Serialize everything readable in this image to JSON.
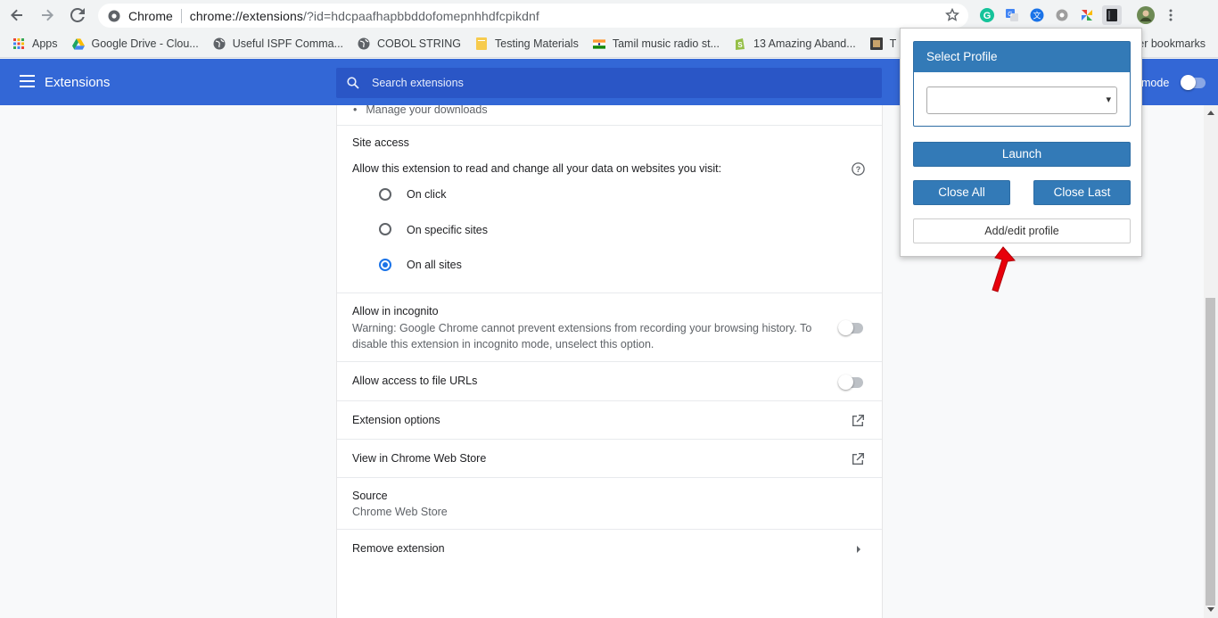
{
  "browser": {
    "omnibox": {
      "site_label": "Chrome",
      "url_scheme_host": "chrome://extensions",
      "url_rest": "/?id=hdcpaafhapbbddofomepnhhdfcpikdnf"
    },
    "bookmarks": [
      {
        "label": "Apps",
        "icon": "apps-grid-icon"
      },
      {
        "label": "Google Drive - Clou...",
        "icon": "google-drive-icon"
      },
      {
        "label": "Useful ISPF Comma...",
        "icon": "globe-icon"
      },
      {
        "label": "COBOL STRING",
        "icon": "globe-icon"
      },
      {
        "label": "Testing Materials",
        "icon": "note-icon"
      },
      {
        "label": "Tamil music radio st...",
        "icon": "india-flag-icon"
      },
      {
        "label": "13 Amazing Aband...",
        "icon": "shopify-icon"
      },
      {
        "label": "T",
        "icon": "bookmark-site-icon"
      }
    ],
    "other_bookmarks": "er bookmarks"
  },
  "header": {
    "title": "Extensions",
    "search_placeholder": "Search extensions",
    "dev_mode_label": "mode"
  },
  "details": {
    "permission_tail": "Manage your downloads",
    "site_access": {
      "label": "Site access",
      "description": "Allow this extension to read and change all your data on websites you visit:",
      "options": [
        {
          "label": "On click",
          "checked": false
        },
        {
          "label": "On specific sites",
          "checked": false
        },
        {
          "label": "On all sites",
          "checked": true
        }
      ]
    },
    "incognito": {
      "label": "Allow in incognito",
      "warning": "Warning: Google Chrome cannot prevent extensions from recording your browsing history. To disable this extension in incognito mode, unselect this option."
    },
    "file_urls": {
      "label": "Allow access to file URLs"
    },
    "extension_options": {
      "label": "Extension options"
    },
    "web_store": {
      "label": "View in Chrome Web Store"
    },
    "source": {
      "label": "Source",
      "value": "Chrome Web Store"
    },
    "remove": {
      "label": "Remove extension"
    }
  },
  "popup": {
    "select_profile_title": "Select Profile",
    "select_value": "",
    "launch_label": "Launch",
    "close_all_label": "Close All",
    "close_last_label": "Close Last",
    "add_edit_label": "Add/edit profile"
  },
  "colors": {
    "header_blue": "#3367d6",
    "popup_button_blue": "#337ab7",
    "radio_checked": "#1a73e8",
    "annotation_arrow": "#e8000b"
  }
}
